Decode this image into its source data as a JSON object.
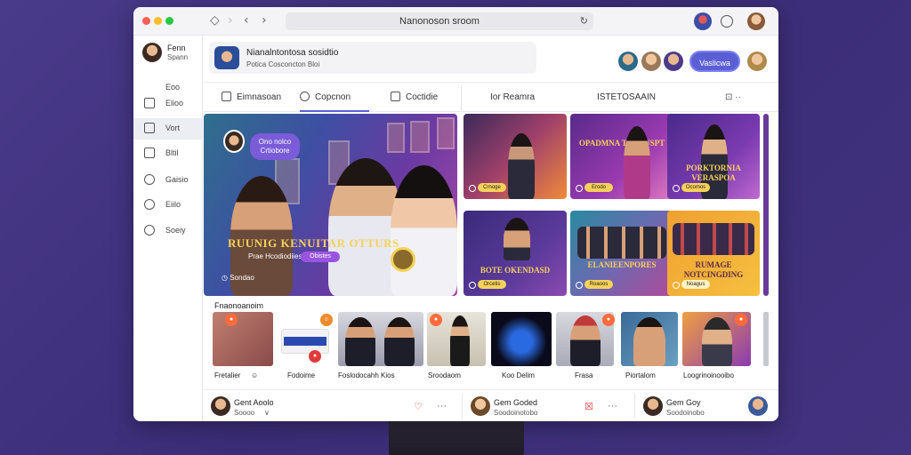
{
  "window": {
    "url": "Nanonoson sroom",
    "reload_icon": "refresh-icon"
  },
  "sidebar": {
    "user": {
      "name": "Fenn",
      "sub": "Spann"
    },
    "items": [
      {
        "label": "Eoo",
        "icon": "home-icon"
      },
      {
        "label": "Elioo",
        "icon": "bookmark-icon"
      },
      {
        "label": "Vort",
        "icon": "book-icon"
      },
      {
        "label": "Bltil",
        "icon": "calendar-icon"
      },
      {
        "label": "Gaisio",
        "icon": "pin-icon"
      },
      {
        "label": "Eiilo",
        "icon": "circle-icon"
      },
      {
        "label": "Soeiy",
        "icon": "globe-icon"
      }
    ]
  },
  "header": {
    "title": "Nianalntontosa sosidtio",
    "subtitle": "Potica Cosconcton Bloi",
    "button_label": "Vaslicwa"
  },
  "tabs": [
    {
      "label": "Eimnasoan",
      "icon": "home-icon"
    },
    {
      "label": "Copcnon",
      "icon": "chat-icon"
    },
    {
      "label": "Coctidie",
      "icon": "square-icon"
    },
    {
      "label": "Ior Reamra",
      "icon": ""
    },
    {
      "label": "ISTETOSAAIN",
      "icon": ""
    }
  ],
  "tabs_more": "⊡ ··",
  "hero": {
    "bubble": "Ono nolco\nCrtiobore",
    "title": "RUUNIG KENUITAR OTTURS",
    "subtitle": "Prae Hcodiodiies",
    "badge": "Obistes",
    "foot": "Sondao"
  },
  "cards": [
    {
      "title": "",
      "pill": "Crnoge"
    },
    {
      "title": "OPADMNA TANOUSPT",
      "pill": "Erodo"
    },
    {
      "title": "PORKTORNIA VERASPOA",
      "pill": "Ocomos"
    },
    {
      "title": "BOTE OKENDASD",
      "pill": "Orcetis"
    },
    {
      "title": "ELANIEENPORES",
      "pill": "Roaoos"
    },
    {
      "title": "RUMAGE NOTCINGDING",
      "pill": "Noagus"
    }
  ],
  "featured": {
    "label": "Fnaonoanoim",
    "items": [
      {
        "label": "Fretalier"
      },
      {
        "label": "Fodoime"
      },
      {
        "label": "Foslodocahh Kios"
      },
      {
        "label": "Sroodaom"
      },
      {
        "label": "Koo Delim"
      },
      {
        "label": "Frasa"
      },
      {
        "label": "Piortalom"
      },
      {
        "label": "Loogrinoinooibo"
      }
    ]
  },
  "footer": [
    {
      "name": "Gent Aoolo",
      "sub": "Soooo"
    },
    {
      "name": "Gem Goded",
      "sub": "Soodoinotobo"
    },
    {
      "name": "Gem Goy",
      "sub": "Soodoinobo"
    }
  ],
  "colors": {
    "accent": "#5b5fd6",
    "background": "#43327f"
  }
}
